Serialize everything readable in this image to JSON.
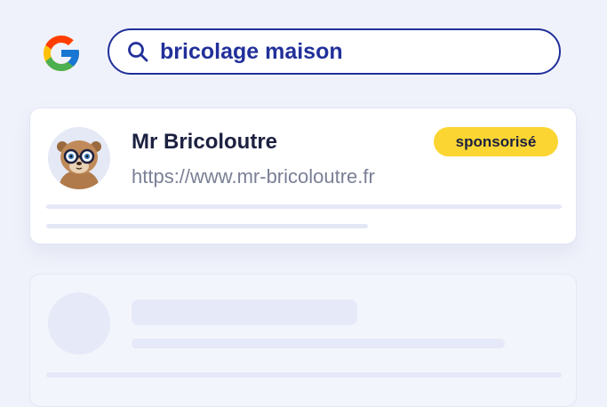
{
  "search": {
    "query": "bricolage maison",
    "icon": "search-icon"
  },
  "logo": {
    "icon": "google-logo-icon"
  },
  "result": {
    "title": "Mr Bricoloutre",
    "url": "https://www.mr-bricoloutre.fr",
    "badge": "sponsorisé",
    "avatar_icon": "otter-avatar-icon"
  },
  "colors": {
    "accent": "#21309a",
    "badge": "#fbd531",
    "background": "#f0f2fb",
    "placeholder": "#e6e9f7"
  }
}
